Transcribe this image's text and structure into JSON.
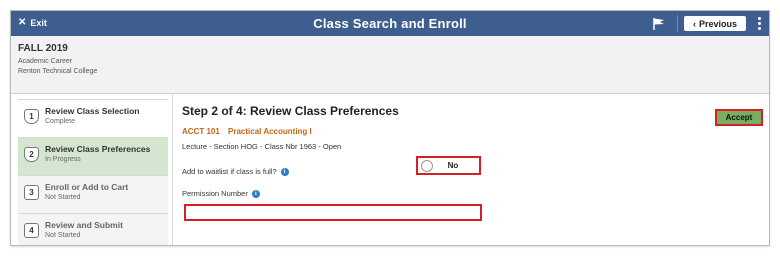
{
  "topbar": {
    "exit_label": "Exit",
    "title": "Class Search and Enroll",
    "previous_label": "Previous",
    "background": "#3e5e8f"
  },
  "term": {
    "name": "FALL 2019",
    "career": "Academic Career",
    "institution": "Renton Technical College"
  },
  "steps": [
    {
      "number": "1",
      "title": "Review Class Selection",
      "status": "Complete"
    },
    {
      "number": "2",
      "title": "Review Class Preferences",
      "status": "In Progress"
    },
    {
      "number": "3",
      "title": "Enroll or Add to Cart",
      "status": "Not Started"
    },
    {
      "number": "4",
      "title": "Review and Submit",
      "status": "Not Started"
    }
  ],
  "main": {
    "heading": "Step 2 of 4: Review Class Preferences",
    "accept_label": "Accept",
    "course_id": "ACCT 101",
    "course_title": "Practical Accounting I",
    "section_line": "Lecture - Section HOG - Class Nbr 1963 - Open",
    "waitlist_label": "Add to waitlist if class is full?",
    "waitlist_value": "No",
    "permission_label": "Permission Number",
    "permission_value": ""
  },
  "colors": {
    "highlight_red": "#d61f26",
    "active_step": "#d5e6d0",
    "accept_green": "#77ae5f",
    "course_orange": "#c0651a"
  }
}
